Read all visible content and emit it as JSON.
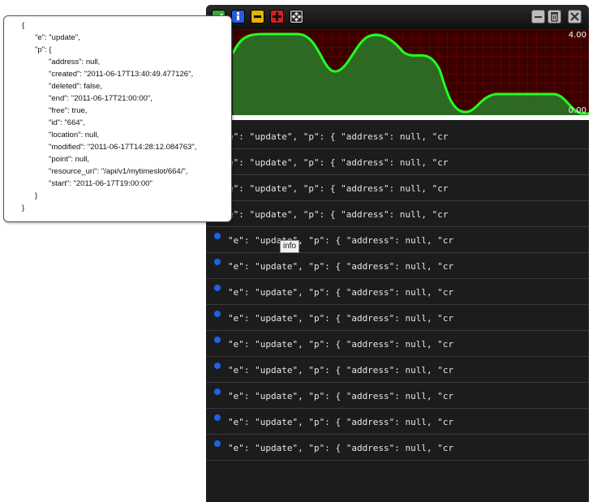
{
  "graph": {
    "max_label": "4.00",
    "min_label": "0.00",
    "colors": {
      "background": "#3a0000",
      "grid": "#8a0000",
      "line": "#20ff20",
      "fill": "#1f7a1f"
    }
  },
  "log_rows": [
    {
      "text": "e\": \"update\", \"p\": { \"address\": null, \"cr",
      "dot": false
    },
    {
      "text": "e\": \"update\", \"p\": { \"address\": null, \"cr",
      "dot": false
    },
    {
      "text": "e\": \"update\", \"p\": { \"address\": null, \"cr",
      "dot": false
    },
    {
      "text": "e\": \"update\", \"p\": { \"address\": null, \"cr",
      "dot": false
    },
    {
      "text": "\"e\": \"update\", \"p\": { \"address\": null, \"cr",
      "dot": true
    },
    {
      "text": "\"e\": \"update\", \"p\": { \"address\": null, \"cr",
      "dot": true
    },
    {
      "text": "\"e\": \"update\", \"p\": { \"address\": null, \"cr",
      "dot": true
    },
    {
      "text": "\"e\": \"update\", \"p\": { \"address\": null, \"cr",
      "dot": true
    },
    {
      "text": "\"e\": \"update\", \"p\": { \"address\": null, \"cr",
      "dot": true
    },
    {
      "text": "\"e\": \"update\", \"p\": { \"address\": null, \"cr",
      "dot": true
    },
    {
      "text": "\"e\": \"update\", \"p\": { \"address\": null, \"cr",
      "dot": true
    },
    {
      "text": "\"e\": \"update\", \"p\": { \"address\": null, \"cr",
      "dot": true
    },
    {
      "text": "\"e\": \"update\", \"p\": { \"address\": null, \"cr",
      "dot": true
    }
  ],
  "tooltip": "info",
  "popup": {
    "open_brace": "{",
    "e_line": "\"e\": \"update\",",
    "p_open": "\"p\": {",
    "fields": [
      "\"address\": null,",
      "\"created\": \"2011-06-17T13:40:49.477126\",",
      "\"deleted\": false,",
      "\"end\": \"2011-06-17T21:00:00\",",
      "\"free\": true,",
      "\"id\": \"664\",",
      "\"location\": null,",
      "\"modified\": \"2011-06-17T14:28:12.084763\",",
      "\"point\": null,",
      "\"resource_uri\": \"/api/v1/mytimeslot/664/\",",
      "\"start\": \"2011-06-17T19:00:00\""
    ],
    "p_close": "}",
    "close_brace": "}"
  },
  "toolbar": {
    "left_icons": [
      "check-icon",
      "info-icon",
      "minus-warning-icon",
      "cross-error-icon",
      "expand-icon"
    ],
    "right_icons": [
      "minimize-icon",
      "trash-icon",
      "close-icon"
    ]
  }
}
